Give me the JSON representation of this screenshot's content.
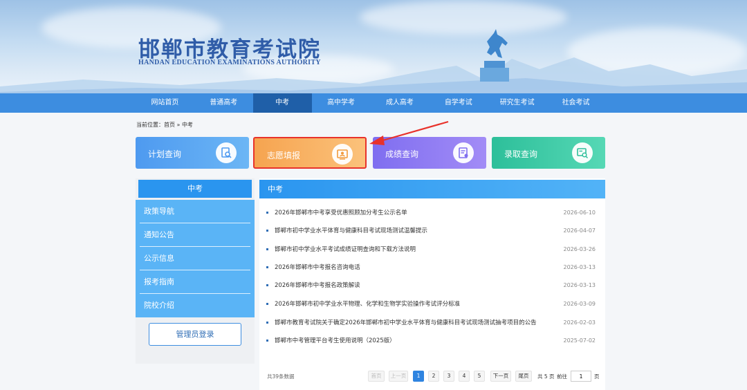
{
  "header": {
    "title_cn": "邯郸市教育考试院",
    "title_en": "HANDAN EDUCATION EXAMINATIONS AUTHORITY"
  },
  "nav": [
    {
      "label": "网站首页",
      "active": false
    },
    {
      "label": "普通高考",
      "active": false
    },
    {
      "label": "中考",
      "active": true
    },
    {
      "label": "高中学考",
      "active": false
    },
    {
      "label": "成人高考",
      "active": false
    },
    {
      "label": "自学考试",
      "active": false
    },
    {
      "label": "研究生考试",
      "active": false
    },
    {
      "label": "社会考试",
      "active": false
    }
  ],
  "breadcrumb": {
    "prefix": "当前位置：",
    "home": "首页",
    "sep": " » ",
    "current": "中考"
  },
  "tiles": [
    {
      "label": "计划查询",
      "icon": "search-doc-icon"
    },
    {
      "label": "志愿填报",
      "icon": "profile-card-icon"
    },
    {
      "label": "成绩查询",
      "icon": "score-doc-icon"
    },
    {
      "label": "录取查询",
      "icon": "admission-search-icon"
    }
  ],
  "sidebar": {
    "title": "中考",
    "items": [
      "政策导航",
      "通知公告",
      "公示信息",
      "报考指南",
      "院校介绍"
    ],
    "admin_button": "管理员登录"
  },
  "main": {
    "title": "中考",
    "articles": [
      {
        "title": "2026年邯郸市中考享受优惠照顾加分考生公示名单",
        "date": "2026-06-10"
      },
      {
        "title": "邯郸市初中学业水平体育与健康科目考试现场测试温馨提示",
        "date": "2026-04-07"
      },
      {
        "title": "邯郸市初中学业水平考试成绩证明查询和下载方法说明",
        "date": "2026-03-26"
      },
      {
        "title": "2026年邯郸市中考报名咨询电话",
        "date": "2026-03-13"
      },
      {
        "title": "2026年邯郸市中考报名政策解读",
        "date": "2026-03-13"
      },
      {
        "title": "2026年邯郸市初中学业水平物理、化学和生物学实验操作考试评分标准",
        "date": "2026-03-09"
      },
      {
        "title": "邯郸市教育考试院关于确定2026年邯郸市初中学业水平体育与健康科目考试现场测试抽考项目的公告",
        "date": "2026-02-03"
      },
      {
        "title": "邯郸市中考管理平台考生使用说明（2025版）",
        "date": "2025-07-02"
      }
    ]
  },
  "pagination": {
    "total": "共39条数据",
    "first": "首页",
    "prev": "上一页",
    "pages": [
      "1",
      "2",
      "3",
      "4",
      "5"
    ],
    "current_page": "1",
    "next": "下一页",
    "last": "尾页",
    "total_pages": "共 5 页",
    "goto": "前往",
    "goto_value": "1",
    "page_unit": "页"
  },
  "colors": {
    "nav": "#3d8de0",
    "nav_active": "#1f5fa8",
    "highlight": "#e8322b"
  }
}
